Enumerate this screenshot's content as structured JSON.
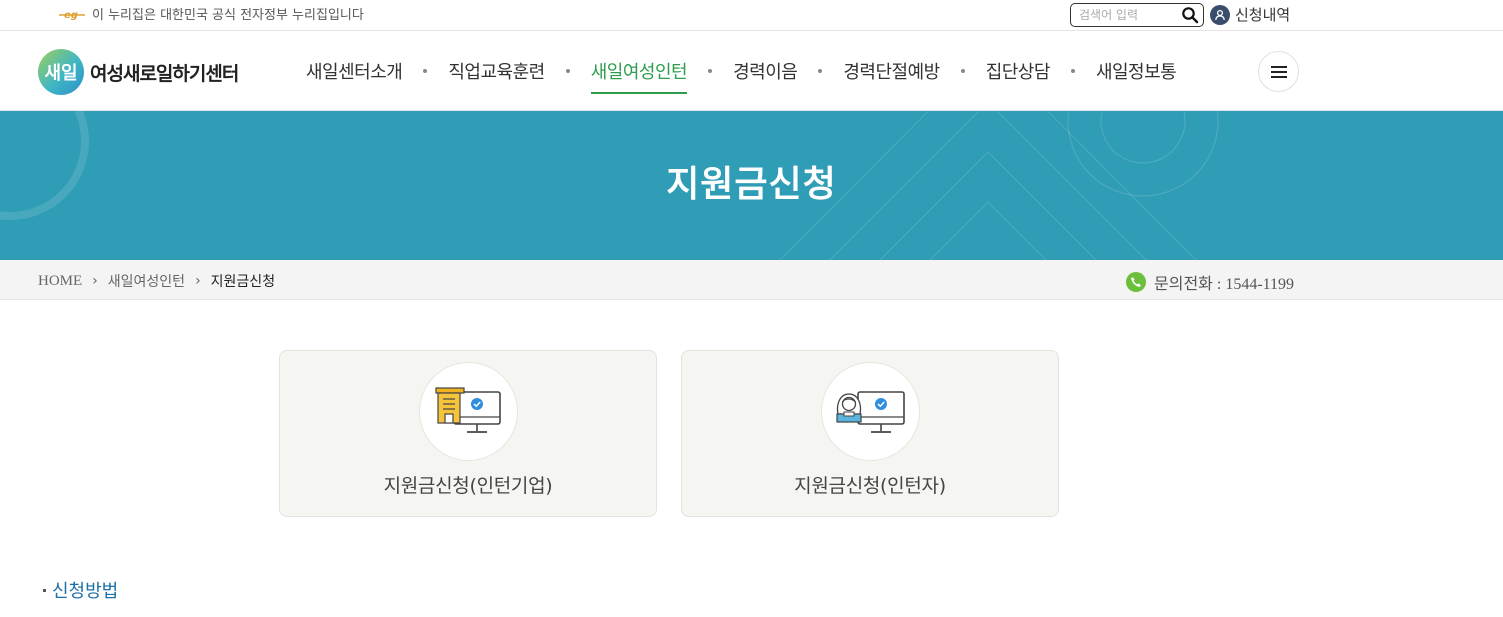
{
  "topbar": {
    "gov_notice": "이 누리집은 대한민국 공식 전자정부 누리집입니다",
    "search_placeholder": "검색어 입력",
    "apply_history_label": "신청내역"
  },
  "header": {
    "logo_mark": "새일",
    "logo_text": "여성새로일하기센터",
    "nav": [
      {
        "label": "새일센터소개"
      },
      {
        "label": "직업교육훈련"
      },
      {
        "label": "새일여성인턴",
        "active": true
      },
      {
        "label": "경력이음"
      },
      {
        "label": "경력단절예방"
      },
      {
        "label": "집단상담"
      },
      {
        "label": "새일정보통"
      }
    ]
  },
  "banner": {
    "title": "지원금신청"
  },
  "breadcrumb": {
    "home": "HOME",
    "parent": "새일여성인턴",
    "current": "지원금신청",
    "separator": "›"
  },
  "contact": {
    "label": "문의전화 : 1544-1199"
  },
  "cards": [
    {
      "label": "지원금신청(인턴기업)",
      "icon": "company-computer-icon"
    },
    {
      "label": "지원금신청(인턴자)",
      "icon": "person-computer-icon"
    }
  ],
  "section": {
    "title": "신청방법"
  },
  "colors": {
    "accent_green": "#2e9e4e",
    "banner": "#2f9db5",
    "link_blue": "#1a6fa6"
  }
}
